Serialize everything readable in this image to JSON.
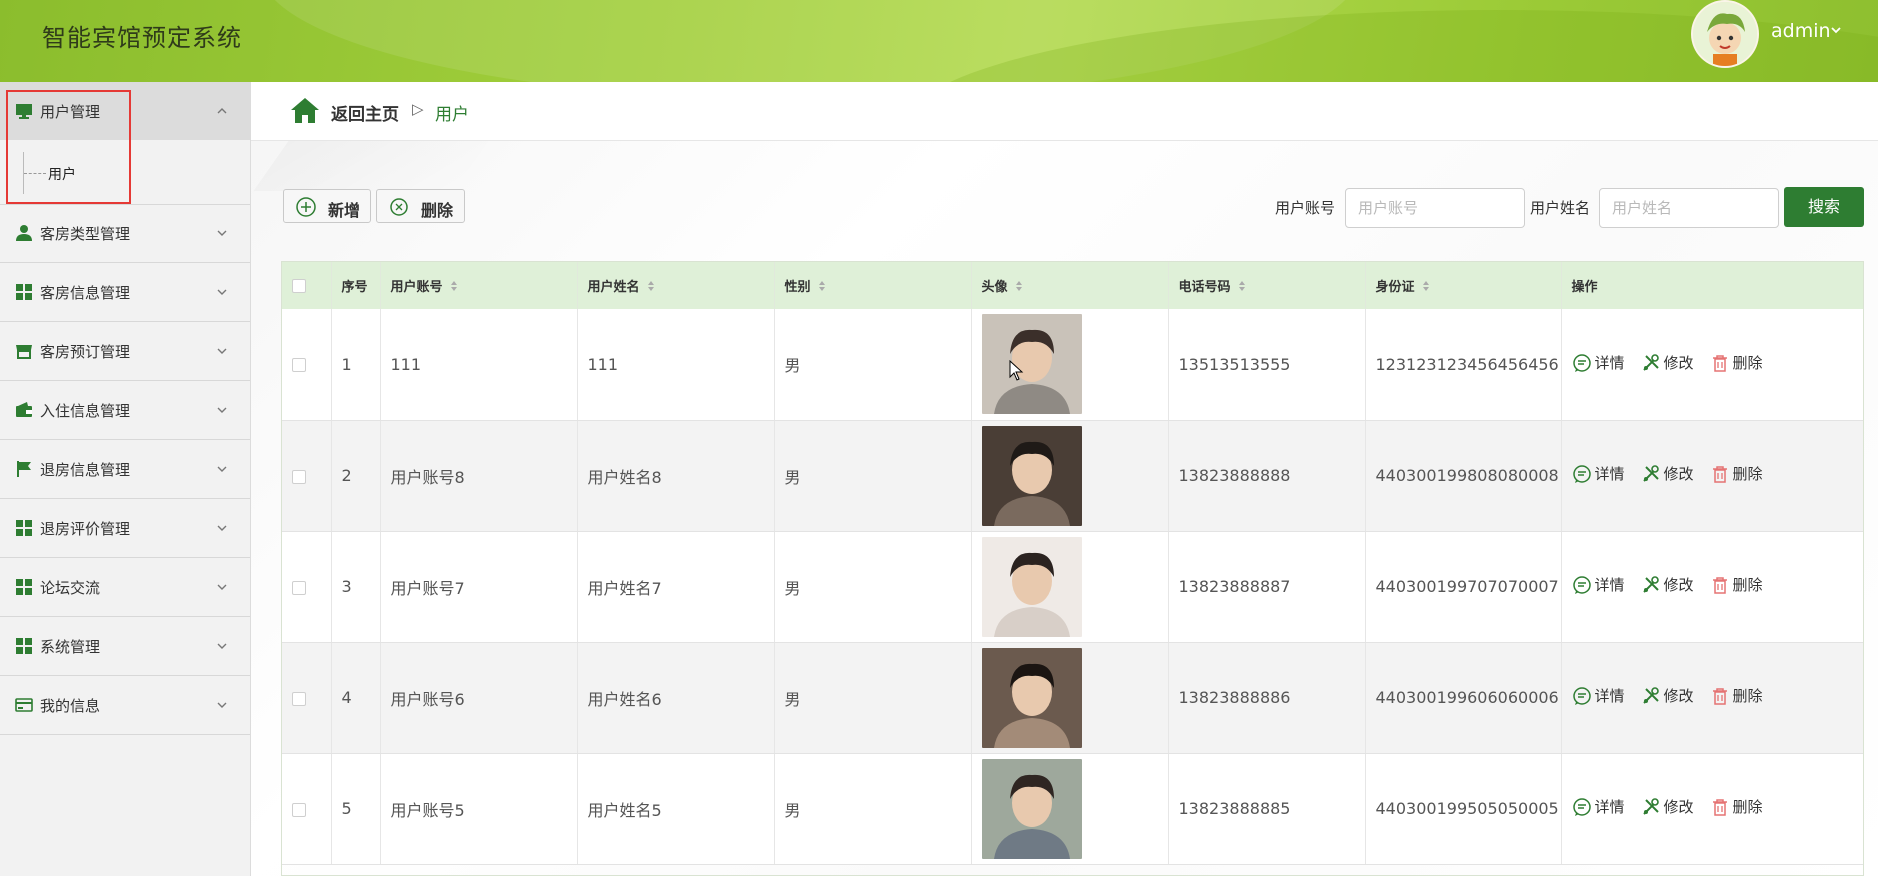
{
  "header": {
    "app_title": "智能宾馆预定系统",
    "user_name": "admin"
  },
  "sidebar": {
    "items": [
      {
        "label": "用户管理",
        "icon": "monitor-icon",
        "expanded": true,
        "children": [
          {
            "label": "用户"
          }
        ]
      },
      {
        "label": "客房类型管理",
        "icon": "person-icon"
      },
      {
        "label": "客房信息管理",
        "icon": "grid-icon"
      },
      {
        "label": "客房预订管理",
        "icon": "store-icon"
      },
      {
        "label": "入住信息管理",
        "icon": "wallet-icon"
      },
      {
        "label": "退房信息管理",
        "icon": "flag-icon"
      },
      {
        "label": "退房评价管理",
        "icon": "grid-icon"
      },
      {
        "label": "论坛交流",
        "icon": "grid-icon"
      },
      {
        "label": "系统管理",
        "icon": "grid-icon"
      },
      {
        "label": "我的信息",
        "icon": "card-icon"
      }
    ]
  },
  "breadcrumb": {
    "home": "返回主页",
    "separator": "▷",
    "current": "用户"
  },
  "toolbar": {
    "add_label": "新增",
    "delete_label": "删除"
  },
  "search": {
    "account_label": "用户账号",
    "account_placeholder": "用户账号",
    "name_label": "用户姓名",
    "name_placeholder": "用户姓名",
    "button_label": "搜索"
  },
  "table": {
    "columns": [
      "序号",
      "用户账号",
      "用户姓名",
      "性别",
      "头像",
      "电话号码",
      "身份证",
      "操作"
    ],
    "rows": [
      {
        "index": "1",
        "account": "111",
        "name": "111",
        "gender": "男",
        "phone": "13513513555",
        "id_card": "123123123456456456"
      },
      {
        "index": "2",
        "account": "用户账号8",
        "name": "用户姓名8",
        "gender": "男",
        "phone": "13823888888",
        "id_card": "440300199808080008"
      },
      {
        "index": "3",
        "account": "用户账号7",
        "name": "用户姓名7",
        "gender": "男",
        "phone": "13823888887",
        "id_card": "440300199707070007"
      },
      {
        "index": "4",
        "account": "用户账号6",
        "name": "用户姓名6",
        "gender": "男",
        "phone": "13823888886",
        "id_card": "440300199606060006"
      },
      {
        "index": "5",
        "account": "用户账号5",
        "name": "用户姓名5",
        "gender": "男",
        "phone": "13823888885",
        "id_card": "440300199505050005"
      }
    ],
    "actions": {
      "detail": "详情",
      "edit": "修改",
      "delete": "删除"
    }
  },
  "colors": {
    "primary": "#2e7d32",
    "header_bg": "#a2cf3c",
    "table_header_bg": "#dff0d8",
    "highlight": "#e53935"
  }
}
